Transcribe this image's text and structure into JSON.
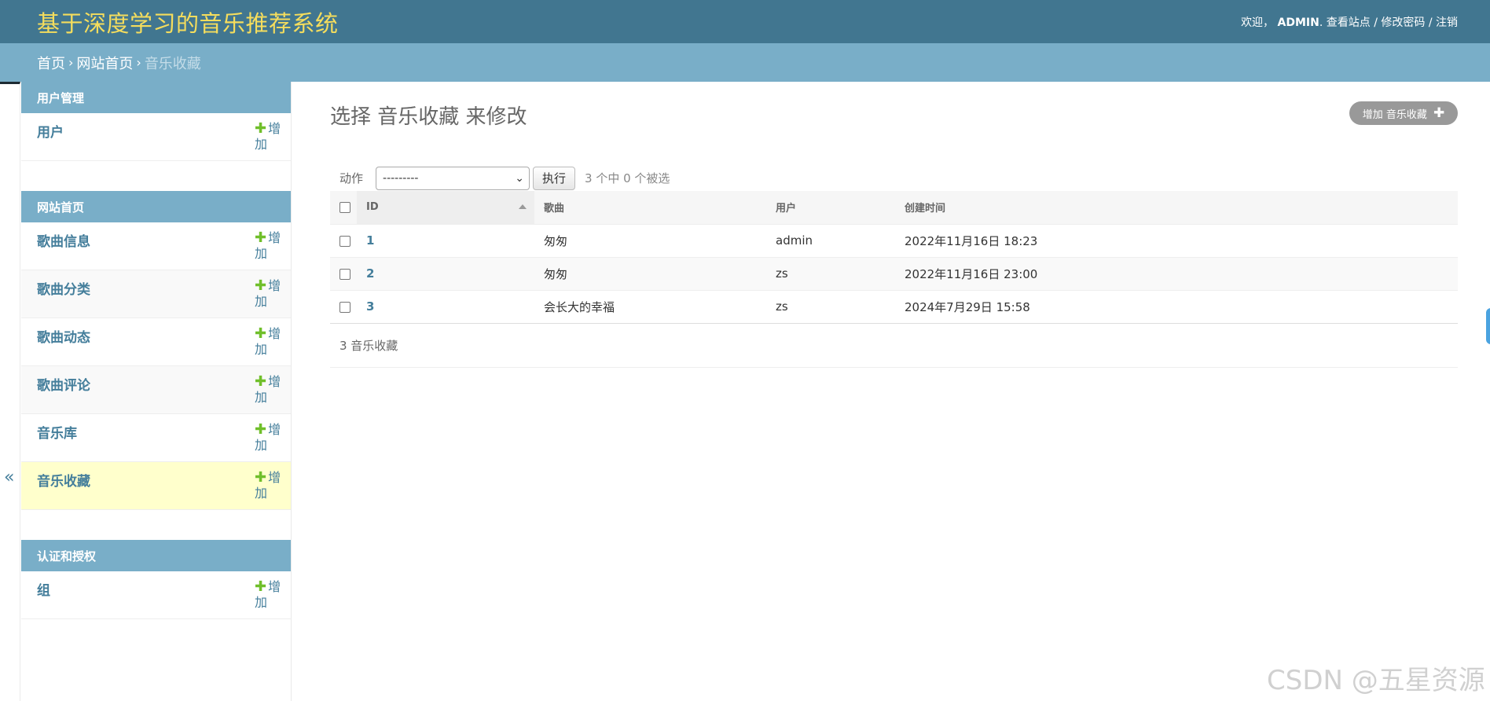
{
  "header": {
    "title": "基于深度学习的音乐推荐系统",
    "welcome": "欢迎，",
    "username": "ADMIN",
    "view_site": "查看站点",
    "change_password": "修改密码",
    "logout": "注销"
  },
  "breadcrumbs": {
    "home": "首页",
    "section": "网站首页",
    "current": "音乐收藏"
  },
  "sidebar": {
    "toggle": "«",
    "add_label_1": "增",
    "add_label_2": "加",
    "modules": [
      {
        "caption": "用户管理",
        "models": [
          "用户"
        ]
      },
      {
        "caption": "网站首页",
        "models": [
          "歌曲信息",
          "歌曲分类",
          "歌曲动态",
          "歌曲评论",
          "音乐库",
          "音乐收藏"
        ]
      },
      {
        "caption": "认证和授权",
        "models": [
          "组"
        ]
      }
    ]
  },
  "main": {
    "title": "选择 音乐收藏 来修改",
    "add_button": "增加 音乐收藏",
    "actions": {
      "label": "动作",
      "selected_option": "---------",
      "go": "执行",
      "selected_count": "3 个中 0 个被选"
    },
    "table": {
      "headers": [
        "ID",
        "歌曲",
        "用户",
        "创建时间"
      ],
      "rows": [
        {
          "id": "1",
          "song": "匆匆",
          "user": "admin",
          "created": "2022年11月16日 18:23"
        },
        {
          "id": "2",
          "song": "匆匆",
          "user": "zs",
          "created": "2022年11月16日 23:00"
        },
        {
          "id": "3",
          "song": "会长大的幸福",
          "user": "zs",
          "created": "2024年7月29日 15:58"
        }
      ]
    },
    "result_count": "3 音乐收藏"
  },
  "watermark": "CSDN @五星资源",
  "colors": {
    "header_bg": "#417690",
    "title": "#f5dd5d",
    "breadcrumb_bg": "#79aec8",
    "link": "#447e9b",
    "add_plus": "#70bf2b",
    "current_row": "#ffffcc"
  }
}
